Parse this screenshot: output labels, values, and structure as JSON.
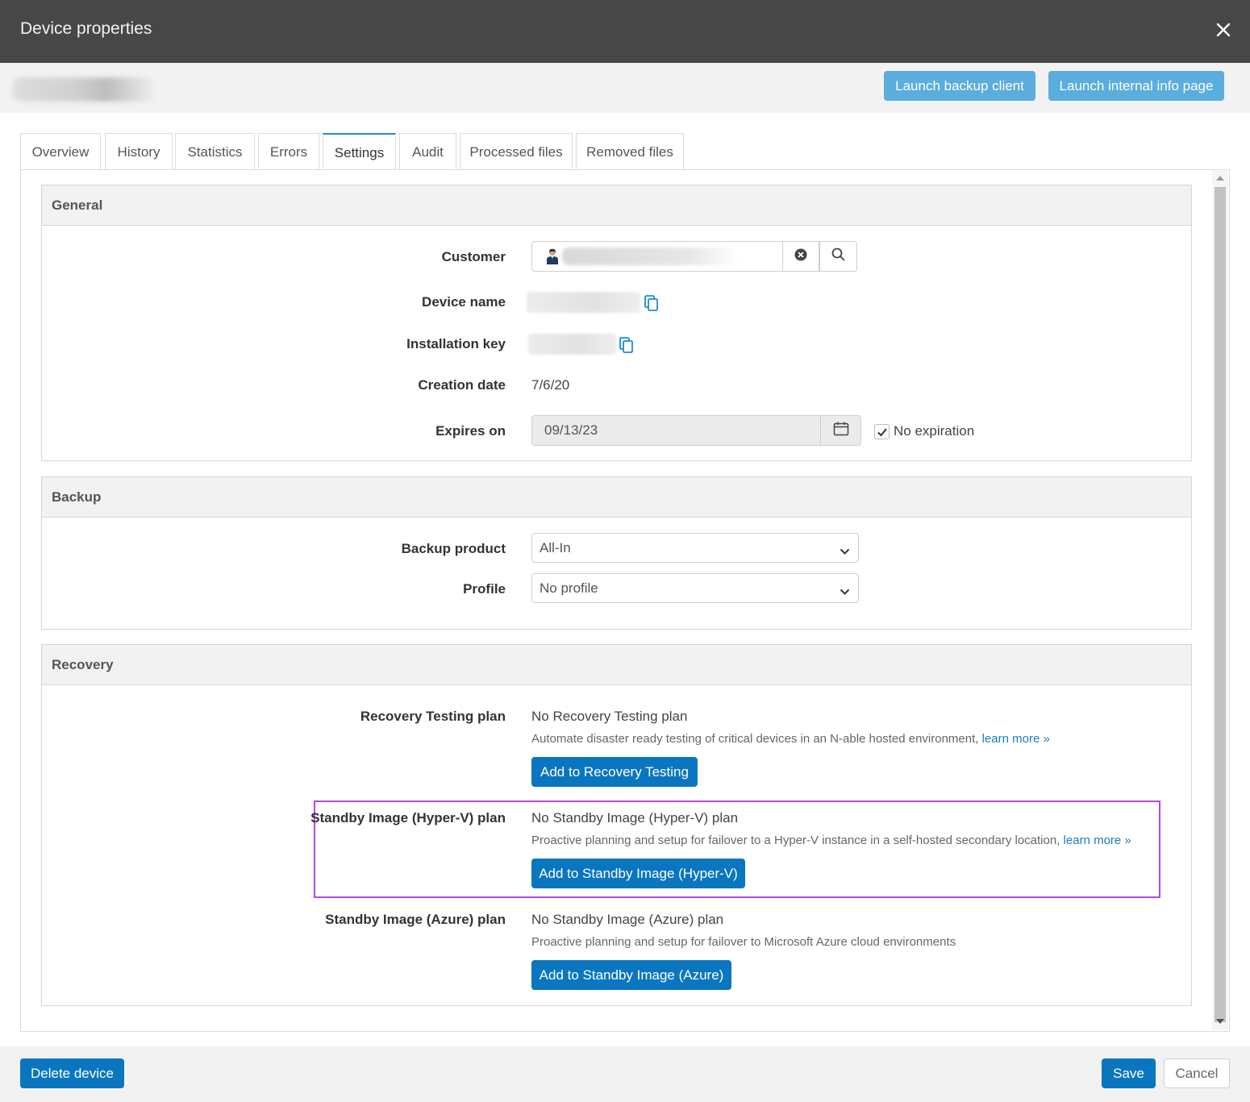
{
  "window": {
    "title": "Device properties",
    "close_icon": "close-icon"
  },
  "header_actions": {
    "launch_backup_client": "Launch backup client",
    "launch_internal_info": "Launch internal info page"
  },
  "tabs": [
    {
      "label": "Overview"
    },
    {
      "label": "History"
    },
    {
      "label": "Statistics"
    },
    {
      "label": "Errors"
    },
    {
      "label": "Settings",
      "active": true
    },
    {
      "label": "Audit"
    },
    {
      "label": "Processed files"
    },
    {
      "label": "Removed files"
    }
  ],
  "general": {
    "heading": "General",
    "customer_label": "Customer",
    "device_name_label": "Device name",
    "installation_key_label": "Installation key",
    "creation_date_label": "Creation date",
    "creation_date": "7/6/20",
    "expires_on_label": "Expires on",
    "expires_on": "09/13/23",
    "no_expiration_label": "No expiration",
    "no_expiration_checked": true
  },
  "backup": {
    "heading": "Backup",
    "backup_product_label": "Backup product",
    "backup_product_value": "All-In",
    "profile_label": "Profile",
    "profile_value": "No profile"
  },
  "recovery": {
    "heading": "Recovery",
    "testing": {
      "label": "Recovery Testing plan",
      "status": "No Recovery Testing plan",
      "description": "Automate disaster ready testing of critical devices in an N-able hosted environment,",
      "link": "learn more »",
      "button": "Add to Recovery Testing"
    },
    "hyperv": {
      "label": "Standby Image (Hyper-V) plan",
      "status": "No Standby Image (Hyper-V) plan",
      "description": "Proactive planning and setup for failover to a Hyper-V instance in a self-hosted secondary location,",
      "link": "learn more »",
      "button": "Add to Standby Image (Hyper-V)"
    },
    "azure": {
      "label": "Standby Image (Azure) plan",
      "status": "No Standby Image (Azure) plan",
      "description": "Proactive planning and setup for failover to Microsoft Azure cloud environments",
      "button": "Add to Standby Image (Azure)"
    }
  },
  "footer": {
    "delete": "Delete device",
    "save": "Save",
    "cancel": "Cancel"
  },
  "colors": {
    "titlebar": "#474747",
    "primary": "#0a76c0",
    "primary_light": "#5aaddc",
    "highlight": "#b548e8",
    "link": "#1a7fc0"
  }
}
